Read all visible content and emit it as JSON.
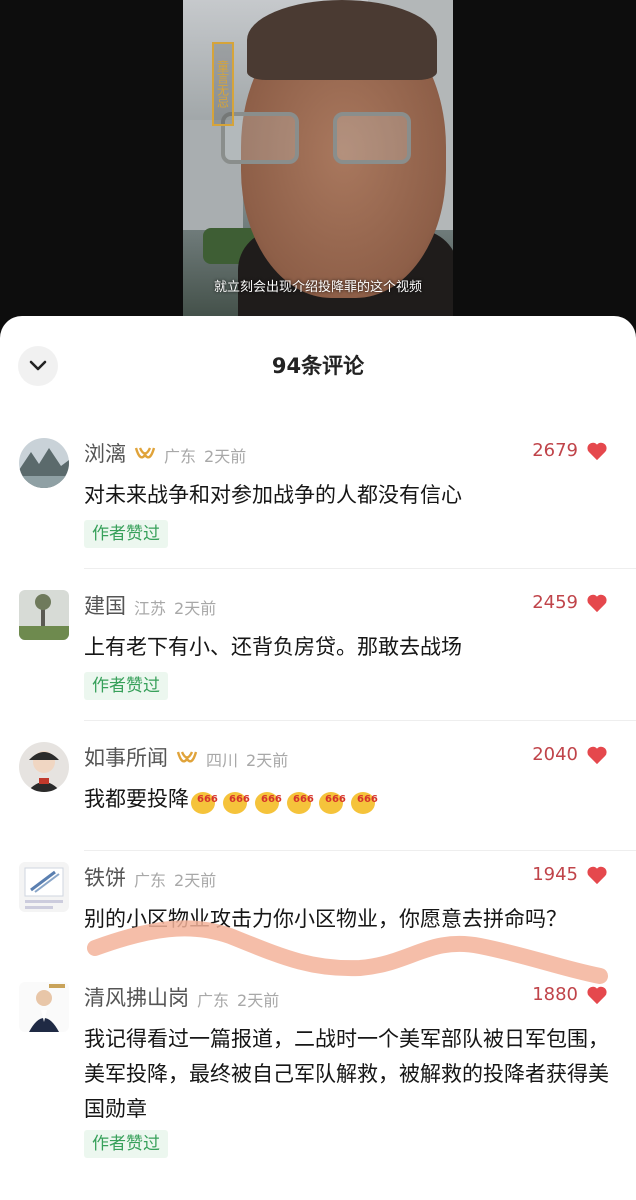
{
  "video": {
    "tag": "童言无忌",
    "subtitle": "就立刻会出现介绍投降罪的这个视频"
  },
  "comments_sheet": {
    "title": "94条评论",
    "comments": [
      {
        "name": "浏漓",
        "has_badge": true,
        "location": "广东",
        "time": "2天前",
        "likes": "2679",
        "text": "对未来战争和对参加战争的人都没有信心",
        "author_liked": "作者赞过"
      },
      {
        "name": "建国",
        "has_badge": false,
        "location": "江苏",
        "time": "2天前",
        "likes": "2459",
        "text": "上有老下有小、还背负房贷。那敢去战场",
        "author_liked": "作者赞过"
      },
      {
        "name": "如事所闻",
        "has_badge": true,
        "location": "四川",
        "time": "2天前",
        "likes": "2040",
        "text": "我都要投降",
        "emoji_label": "666",
        "emoji_count": 6
      },
      {
        "name": "铁饼",
        "has_badge": false,
        "location": "广东",
        "time": "2天前",
        "likes": "1945",
        "text": "别的小区物业攻击力你小区物业，你愿意去拼命吗？"
      },
      {
        "name": "清风拂山岗",
        "has_badge": false,
        "location": "广东",
        "time": "2天前",
        "likes": "1880",
        "text": "我记得看过一篇报道，二战时一个美军部队被日军包围，美军投降，最终被自己军队解救，被解救的投降者获得美国勋章",
        "author_liked": "作者赞过"
      }
    ]
  },
  "colors": {
    "like_count": "#c0444a",
    "heart": "#e5484d",
    "author_liked_text": "#37a05a",
    "author_liked_bg": "#ecf7ef",
    "badge": "#e0a33a",
    "scribble": "#f3b39a"
  }
}
